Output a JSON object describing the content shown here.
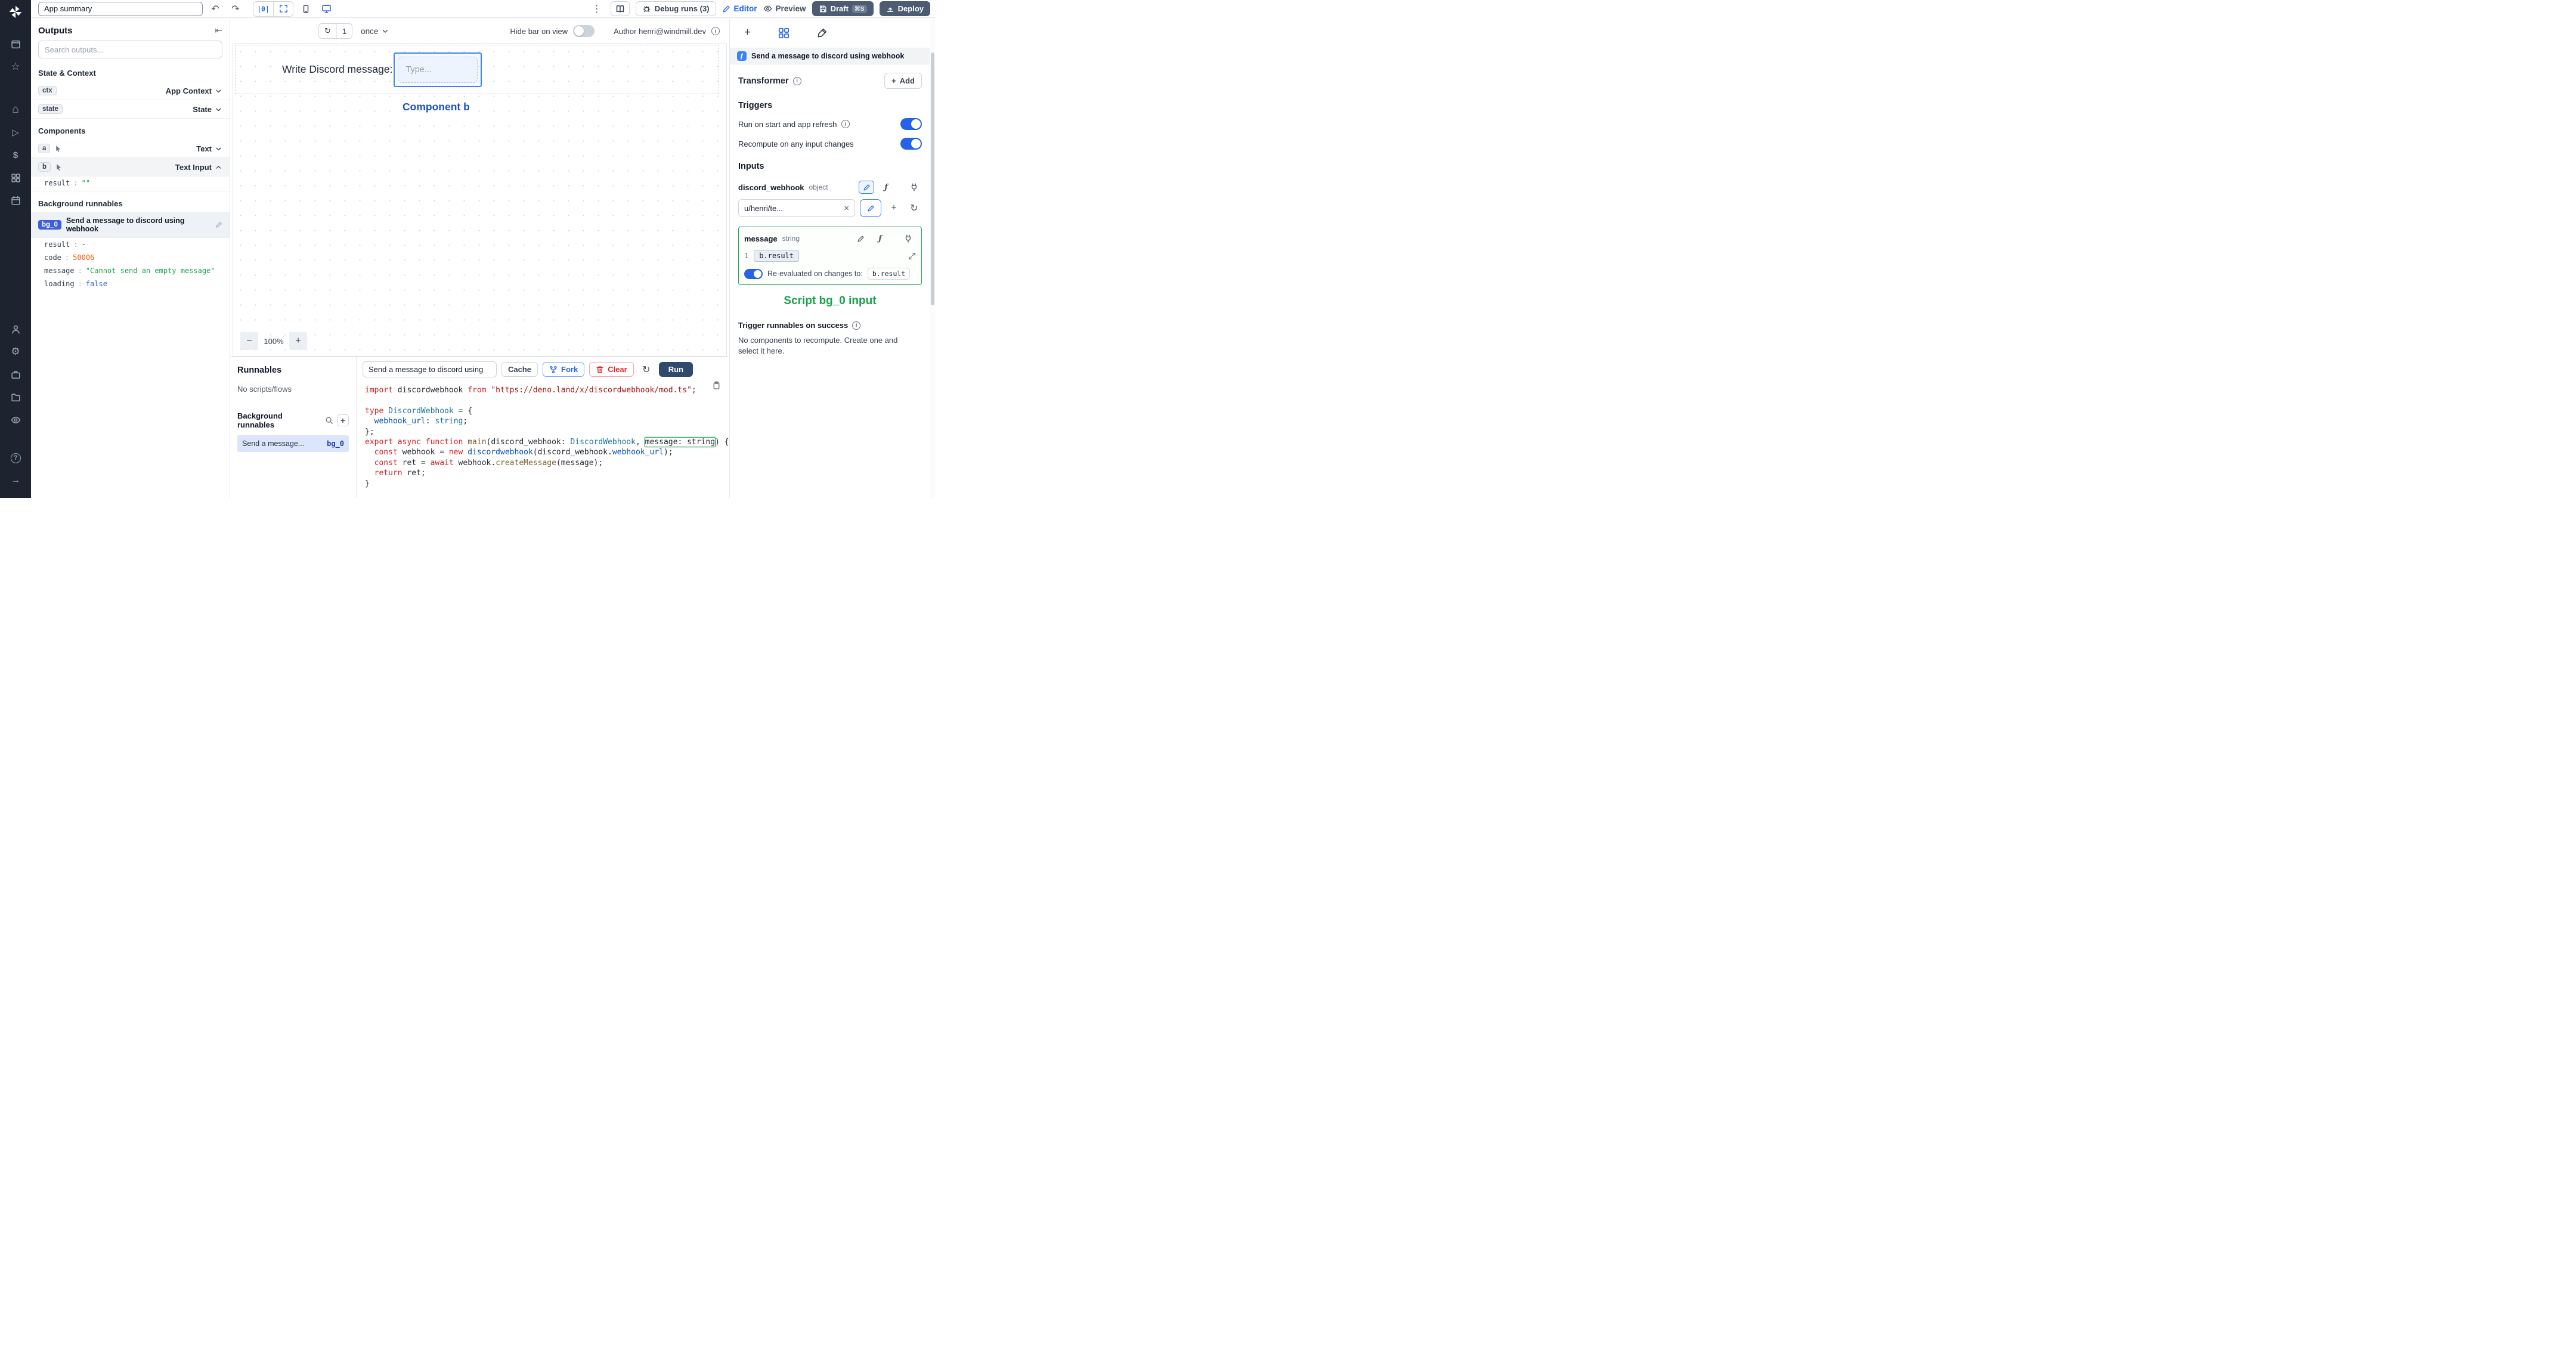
{
  "topbar": {
    "app_summary": "App summary",
    "align_glyph": "|0|",
    "debug_runs": "Debug runs  (3)",
    "editor": "Editor",
    "preview": "Preview",
    "draft": "Draft",
    "draft_shortcut": "⌘S",
    "deploy": "Deploy"
  },
  "left_panel": {
    "outputs_title": "Outputs",
    "search_placeholder": "Search outputs...",
    "state_context_title": "State & Context",
    "components_title": "Components",
    "background_title": "Background runnables",
    "ctx": {
      "badge": "ctx",
      "label": "App Context"
    },
    "state": {
      "badge": "state",
      "label": "State"
    },
    "comp_a": {
      "badge": "a",
      "label": "Text"
    },
    "comp_b": {
      "badge": "b",
      "label": "Text Input"
    },
    "comp_b_result": {
      "key": "result",
      "sep": ":",
      "value": "\"\""
    },
    "bg0": {
      "badge": "bg_0",
      "label": "Send a message to discord using webhook",
      "fields": [
        {
          "key": "result",
          "sep": ":",
          "value": "-",
          "type": "plain"
        },
        {
          "key": "code",
          "sep": ":",
          "value": "50006",
          "type": "number"
        },
        {
          "key": "message",
          "sep": ":",
          "value": "\"Cannot send an empty message\"",
          "type": "string"
        },
        {
          "key": "loading",
          "sep": ":",
          "value": "false",
          "type": "boolean"
        }
      ]
    }
  },
  "canvas": {
    "refresh_count": "1",
    "interval": "once",
    "hide_bar_label": "Hide bar on view",
    "author": "Author henri@windmill.dev",
    "component_text": "Write Discord message:",
    "input_placeholder": "Type...",
    "selection_label": "Component b",
    "zoom": "100%"
  },
  "runnables": {
    "title": "Runnables",
    "empty": "No scripts/flows",
    "background_title": "Background runnables",
    "item_label": "Send a message...",
    "item_badge": "bg_0"
  },
  "code_panel": {
    "title": "Send a message to discord using",
    "cache": "Cache",
    "fork": "Fork",
    "clear": "Clear",
    "run": "Run",
    "lines": [
      [
        [
          "kw",
          "import"
        ],
        [
          "pl",
          " discordwebhook "
        ],
        [
          "kw",
          "from"
        ],
        [
          "pl",
          " "
        ],
        [
          "str",
          "\"https://deno.land/x/discordwebhook/mod.ts\""
        ],
        [
          "pl",
          ";"
        ]
      ],
      [],
      [
        [
          "kw",
          "type"
        ],
        [
          "pl",
          " "
        ],
        [
          "type",
          "DiscordWebhook"
        ],
        [
          "pl",
          " = {"
        ]
      ],
      [
        [
          "pl",
          "  "
        ],
        [
          "prop",
          "webhook_url"
        ],
        [
          "pl",
          ": "
        ],
        [
          "type",
          "string"
        ],
        [
          "pl",
          ";"
        ]
      ],
      [
        [
          "pl",
          "};"
        ]
      ],
      [
        [
          "kw",
          "export"
        ],
        [
          "pl",
          " "
        ],
        [
          "kw",
          "async"
        ],
        [
          "pl",
          " "
        ],
        [
          "kw",
          "function"
        ],
        [
          "pl",
          " "
        ],
        [
          "fn",
          "main"
        ],
        [
          "pl",
          "(discord_webhook: "
        ],
        [
          "type",
          "DiscordWebhook"
        ],
        [
          "pl",
          ", "
        ],
        [
          "hl",
          "message: string"
        ],
        [
          "pl",
          ") {"
        ]
      ],
      [
        [
          "pl",
          "  "
        ],
        [
          "kw",
          "const"
        ],
        [
          "pl",
          " webhook = "
        ],
        [
          "kw",
          "new"
        ],
        [
          "pl",
          " "
        ],
        [
          "var",
          "discordwebhook"
        ],
        [
          "pl",
          "(discord_webhook."
        ],
        [
          "prop",
          "webhook_url"
        ],
        [
          "pl",
          ");"
        ]
      ],
      [
        [
          "pl",
          "  "
        ],
        [
          "kw",
          "const"
        ],
        [
          "pl",
          " ret = "
        ],
        [
          "kw",
          "await"
        ],
        [
          "pl",
          " webhook."
        ],
        [
          "fn",
          "createMessage"
        ],
        [
          "pl",
          "(message);"
        ]
      ],
      [
        [
          "pl",
          "  "
        ],
        [
          "kw",
          "return"
        ],
        [
          "pl",
          " ret;"
        ]
      ],
      [
        [
          "pl",
          "}"
        ]
      ]
    ]
  },
  "right_panel": {
    "header_title": "Send a message to discord using webhook",
    "transformer": "Transformer",
    "add": "Add",
    "triggers_title": "Triggers",
    "trigger_rows": [
      "Run on start and app refresh",
      "Recompute on any input changes"
    ],
    "inputs_title": "Inputs",
    "discord": {
      "name": "discord_webhook",
      "type": "object",
      "value": "u/henri/te..."
    },
    "message": {
      "name": "message",
      "type": "string",
      "line": "1",
      "expr": "b.result"
    },
    "reeval_label": "Re-evaluated on changes to:",
    "reeval_value": "b.result",
    "annotation": "Script bg_0 input",
    "success_title": "Trigger runnables on success",
    "success_body": "No components to recompute. Create one and select it here."
  },
  "glyphs": {
    "undo": "↶",
    "redo": "↷",
    "kebab": "⋮",
    "refresh": "↻",
    "minus": "−",
    "plus": "+",
    "close": "×",
    "fn": "ƒ",
    "info": "i",
    "collapse": "⇤",
    "star": "☆",
    "home": "⌂",
    "play": "▷",
    "dollar": "$",
    "gear": "⚙",
    "arrow_right": "→",
    "question": "?"
  }
}
